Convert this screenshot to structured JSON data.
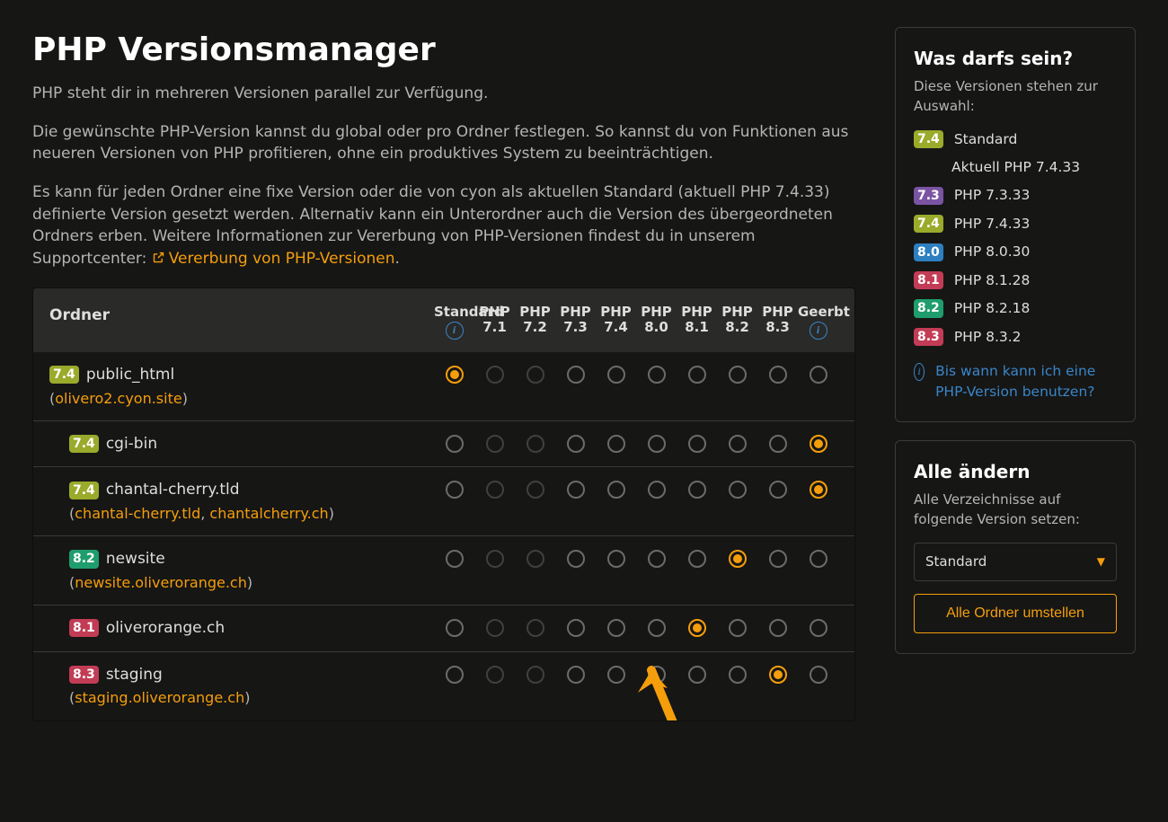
{
  "colors": {
    "7.3": "#7a54a3",
    "7.4": "#9aaa2b",
    "8.0": "#2d7fc0",
    "8.1": "#c23c55",
    "8.2": "#1f9d6e",
    "8.3": "#c23c55"
  },
  "header": {
    "title": "PHP Versionsmanager",
    "p1": "PHP steht dir in mehreren Versionen parallel zur Verfügung.",
    "p2": "Die gewünschte PHP-Version kannst du global oder pro Ordner festlegen. So kannst du von Funktionen aus neueren Versionen von PHP profitieren, ohne ein produktives System zu beeinträchtigen.",
    "p3_a": "Es kann für jeden Ordner eine fixe Version oder die von cyon als aktuellen Standard (aktuell PHP 7.4.33) definierte Version gesetzt werden. Alternativ kann ein Unterordner auch die Version des übergeordneten Ordners erben. Weitere Informationen zur Vererbung von PHP-Versionen findest du in unserem Supportcenter: ",
    "p3_link": "Vererbung von PHP-Versionen",
    "p3_b": "."
  },
  "table": {
    "col_folder": "Ordner",
    "columns": [
      "Standard",
      "PHP 7.1",
      "PHP 7.2",
      "PHP 7.3",
      "PHP 7.4",
      "PHP 8.0",
      "PHP 8.1",
      "PHP 8.2",
      "PHP 8.3",
      "Geerbt"
    ],
    "info_cols": [
      0,
      9
    ],
    "disabled_cols": [
      1,
      2
    ],
    "rows": [
      {
        "indent": 0,
        "badge": "7.4",
        "name": "public_html",
        "sub": [
          "olivero2.cyon.site"
        ],
        "selected": 0
      },
      {
        "indent": 1,
        "badge": "7.4",
        "name": "cgi-bin",
        "sub": [],
        "selected": 9
      },
      {
        "indent": 1,
        "badge": "7.4",
        "name": "chantal-cherry.tld",
        "sub": [
          "chantal-cherry.tld",
          "chantalcherry.ch"
        ],
        "selected": 9
      },
      {
        "indent": 1,
        "badge": "8.2",
        "name": "newsite",
        "sub": [
          "newsite.oliverorange.ch"
        ],
        "selected": 7
      },
      {
        "indent": 1,
        "badge": "8.1",
        "name": "oliverorange.ch",
        "sub": [],
        "selected": 6
      },
      {
        "indent": 1,
        "badge": "8.3",
        "name": "staging",
        "sub": [
          "staging.oliverorange.ch"
        ],
        "selected": 8
      }
    ]
  },
  "side_versions": {
    "title": "Was darfs sein?",
    "subtitle": "Diese Versionen stehen zur Auswahl:",
    "items": [
      {
        "badge": "7.4",
        "label": "Standard"
      },
      {
        "badge": "",
        "label": "Aktuell PHP 7.4.33"
      },
      {
        "badge": "7.3",
        "label": "PHP 7.3.33"
      },
      {
        "badge": "7.4",
        "label": "PHP 7.4.33"
      },
      {
        "badge": "8.0",
        "label": "PHP 8.0.30"
      },
      {
        "badge": "8.1",
        "label": "PHP 8.1.28"
      },
      {
        "badge": "8.2",
        "label": "PHP 8.2.18"
      },
      {
        "badge": "8.3",
        "label": "PHP 8.3.2"
      }
    ],
    "help_link": "Bis wann kann ich eine PHP-Version benutzen?"
  },
  "side_change": {
    "title": "Alle ändern",
    "subtitle": "Alle Verzeichnisse auf folgende Version setzen:",
    "select_value": "Standard",
    "button": "Alle Ordner umstellen"
  }
}
